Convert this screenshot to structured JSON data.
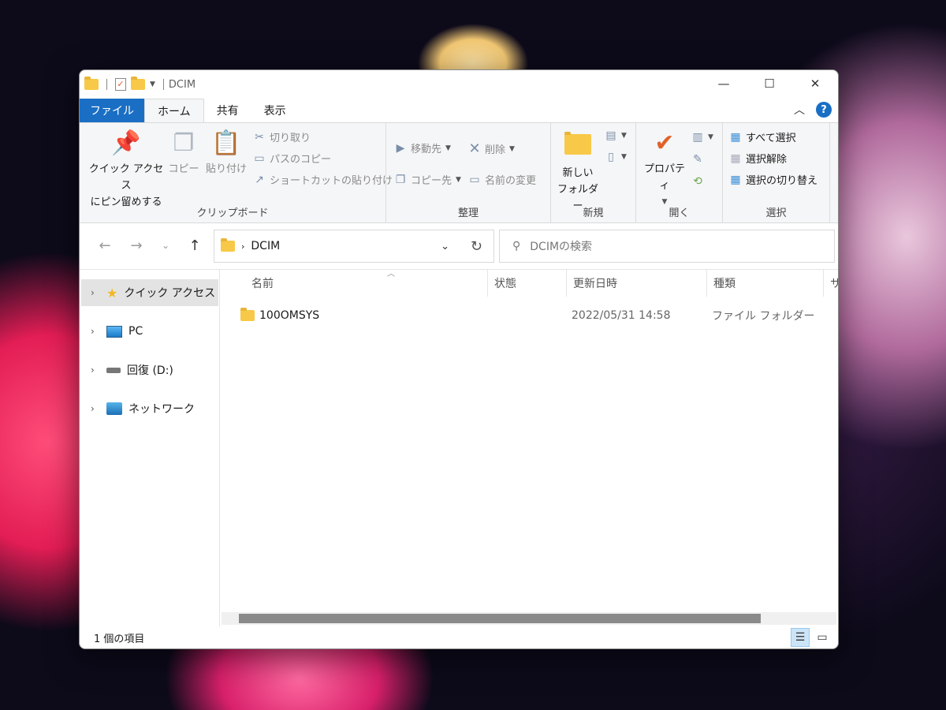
{
  "window": {
    "title": "DCIM",
    "controls": {
      "minimize": "—",
      "maximize": "☐",
      "close": "✕"
    }
  },
  "tabs": [
    {
      "label": "ファイル"
    },
    {
      "label": "ホーム"
    },
    {
      "label": "共有"
    },
    {
      "label": "表示"
    }
  ],
  "ribbon": {
    "clipboard": {
      "label": "クリップボード",
      "pin_line1": "クイック アクセス",
      "pin_line2": "にピン留めする",
      "copy": "コピー",
      "paste": "貼り付け",
      "cut": "切り取り",
      "copy_path": "パスのコピー",
      "paste_shortcut": "ショートカットの貼り付け"
    },
    "organize": {
      "label": "整理",
      "move_to": "移動先",
      "copy_to": "コピー先",
      "delete": "削除",
      "rename": "名前の変更"
    },
    "new": {
      "label": "新規",
      "new_folder_line1": "新しい",
      "new_folder_line2": "フォルダー"
    },
    "open": {
      "label": "開く",
      "properties": "プロパティ"
    },
    "select": {
      "label": "選択",
      "select_all": "すべて選択",
      "select_none": "選択解除",
      "invert": "選択の切り替え"
    }
  },
  "address": {
    "path": "DCIM",
    "search_placeholder": "DCIMの検索"
  },
  "nav_pane": [
    {
      "label": "クイック アクセス",
      "selected": true
    },
    {
      "label": "PC"
    },
    {
      "label": "回復 (D:)"
    },
    {
      "label": "ネットワーク"
    }
  ],
  "columns": [
    "名前",
    "状態",
    "更新日時",
    "種類",
    "サ"
  ],
  "files": [
    {
      "name": "100OMSYS",
      "status": "",
      "modified": "2022/05/31 14:58",
      "type": "ファイル フォルダー"
    }
  ],
  "status_bar": {
    "item_count": "1 個の項目"
  }
}
